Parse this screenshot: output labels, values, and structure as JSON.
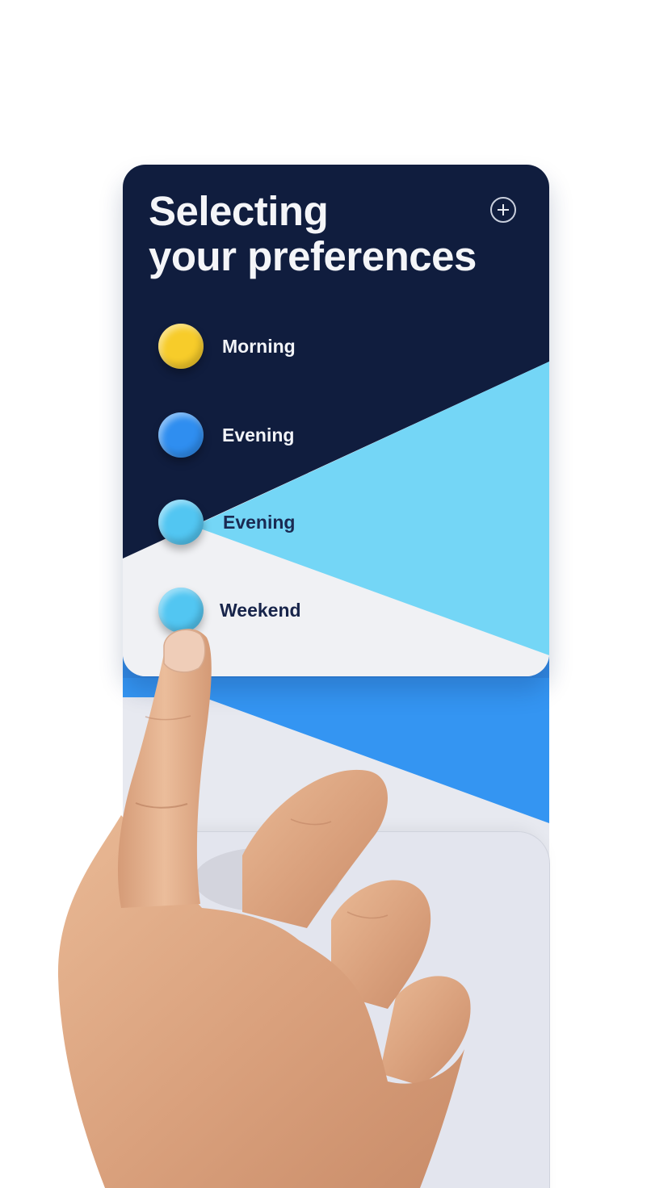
{
  "card": {
    "title_line1": "Selecting",
    "title_line2": "your preferences",
    "add_icon": "plus-circle-icon",
    "options": [
      {
        "label": "Morning",
        "color": "#f7cc2a"
      },
      {
        "label": "Evening",
        "color": "#2f8ef0"
      },
      {
        "label": "Evening",
        "color": "#52c6f2"
      },
      {
        "label": "Weekend",
        "color": "#52c6f2"
      }
    ]
  },
  "colors": {
    "navy": "#101d3e",
    "sky": "#74d6f6",
    "blue": "#3495f2",
    "card_white": "#f0f1f4",
    "panel": "#e7e9f0"
  }
}
